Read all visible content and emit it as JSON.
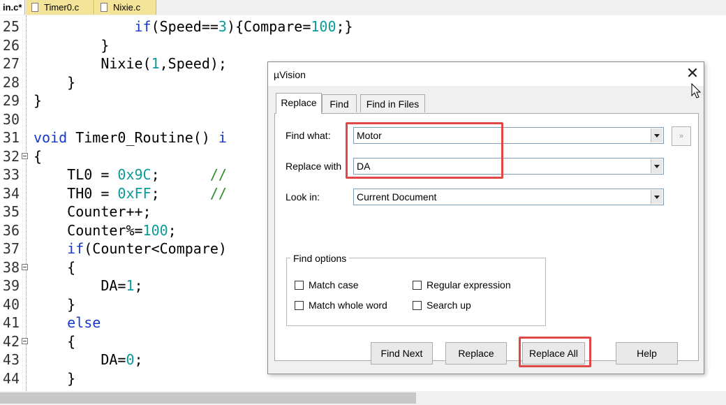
{
  "tabs": [
    {
      "label": "in.c*",
      "active": true
    },
    {
      "label": "Timer0.c",
      "active": false
    },
    {
      "label": "Nixie.c",
      "active": false
    }
  ],
  "editor": {
    "line_numbers": [
      "25",
      "26",
      "27",
      "28",
      "29",
      "30",
      "31",
      "32",
      "33",
      "34",
      "35",
      "36",
      "37",
      "38",
      "39",
      "40",
      "41",
      "42",
      "43",
      "44"
    ],
    "lines": [
      [
        "            ",
        [
          "kw",
          "if"
        ],
        "(Speed==",
        [
          "num",
          "3"
        ],
        "){Compare=",
        [
          "num",
          "100"
        ],
        ";}"
      ],
      [
        "        }"
      ],
      [
        "        Nixie(",
        [
          "num",
          "1"
        ],
        ",Speed);"
      ],
      [
        "    }"
      ],
      [
        "}"
      ],
      [
        ""
      ],
      [
        [
          "kw",
          "void"
        ],
        " Timer0_Routine() ",
        [
          "kw",
          "i"
        ]
      ],
      [
        "{"
      ],
      [
        "    TL0 = ",
        [
          "num",
          "0x9C"
        ],
        ";      ",
        [
          "cm",
          "//"
        ]
      ],
      [
        "    TH0 = ",
        [
          "num",
          "0xFF"
        ],
        ";      ",
        [
          "cm",
          "//"
        ]
      ],
      [
        "    Counter++;"
      ],
      [
        "    Counter%=",
        [
          "num",
          "100"
        ],
        ";"
      ],
      [
        "    ",
        [
          "kw",
          "if"
        ],
        "(Counter<Compare)"
      ],
      [
        "    {"
      ],
      [
        "        DA=",
        [
          "num",
          "1"
        ],
        ";"
      ],
      [
        "    }"
      ],
      [
        "    ",
        [
          "kw",
          "else"
        ]
      ],
      [
        "    {"
      ],
      [
        "        DA=",
        [
          "num",
          "0"
        ],
        ";"
      ],
      [
        "    }"
      ]
    ],
    "fold_lines": [
      "32",
      "38",
      "42"
    ]
  },
  "dialog": {
    "title": "µVision",
    "close_symbol": "✕",
    "tabs": [
      "Replace",
      "Find",
      "Find in Files"
    ],
    "selected_tab": "Replace",
    "find_what_label": "Find what:",
    "find_what_value": "Motor",
    "replace_with_label": "Replace with",
    "replace_with_value": "DA",
    "look_in_label": "Look in:",
    "look_in_value": "Current Document",
    "expand_symbol": "»",
    "find_options_label": "Find options",
    "options": {
      "match_case": "Match case",
      "match_whole_word": "Match whole word",
      "regular_expression": "Regular expression",
      "search_up": "Search up"
    },
    "buttons": {
      "find_next": "Find Next",
      "replace": "Replace",
      "replace_all": "Replace All",
      "help": "Help"
    }
  },
  "colors": {
    "keyword": "#1a38c8",
    "number": "#0a9a9a",
    "comment": "#2e8b2e",
    "highlight": "#e04848",
    "tab_inactive": "#f3e49a"
  }
}
